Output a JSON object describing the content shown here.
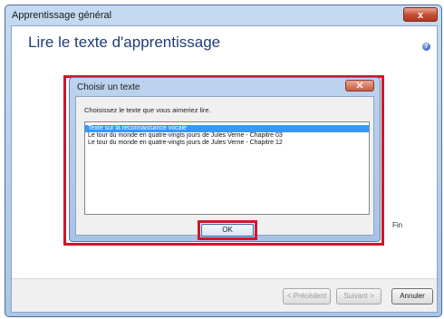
{
  "window": {
    "title": "Apprentissage général",
    "close_glyph": "x",
    "heading": "Lire le texte d'apprentissage",
    "help_glyph": "?",
    "background_fragment": "Fin"
  },
  "footer": {
    "previous_label": "< Précédent",
    "next_label": "Suivant >",
    "cancel_label": "Annuler"
  },
  "dialog": {
    "title": "Choisir un texte",
    "prompt": "Choisissez le texte que vous aimeriez lire.",
    "options": [
      "Texte sur la reconnaissance vocale",
      "Le tour du monde en quatre-vingts jours de Jules Verne - Chapitre 03",
      "Le tour du monde en quatre-vingts jours de Jules Verne - Chapitre 12"
    ],
    "selected_index": 0,
    "ok_label": "OK"
  },
  "colors": {
    "highlight": "#d0172a",
    "selection": "#3399ff",
    "heading": "#1f3d78"
  }
}
